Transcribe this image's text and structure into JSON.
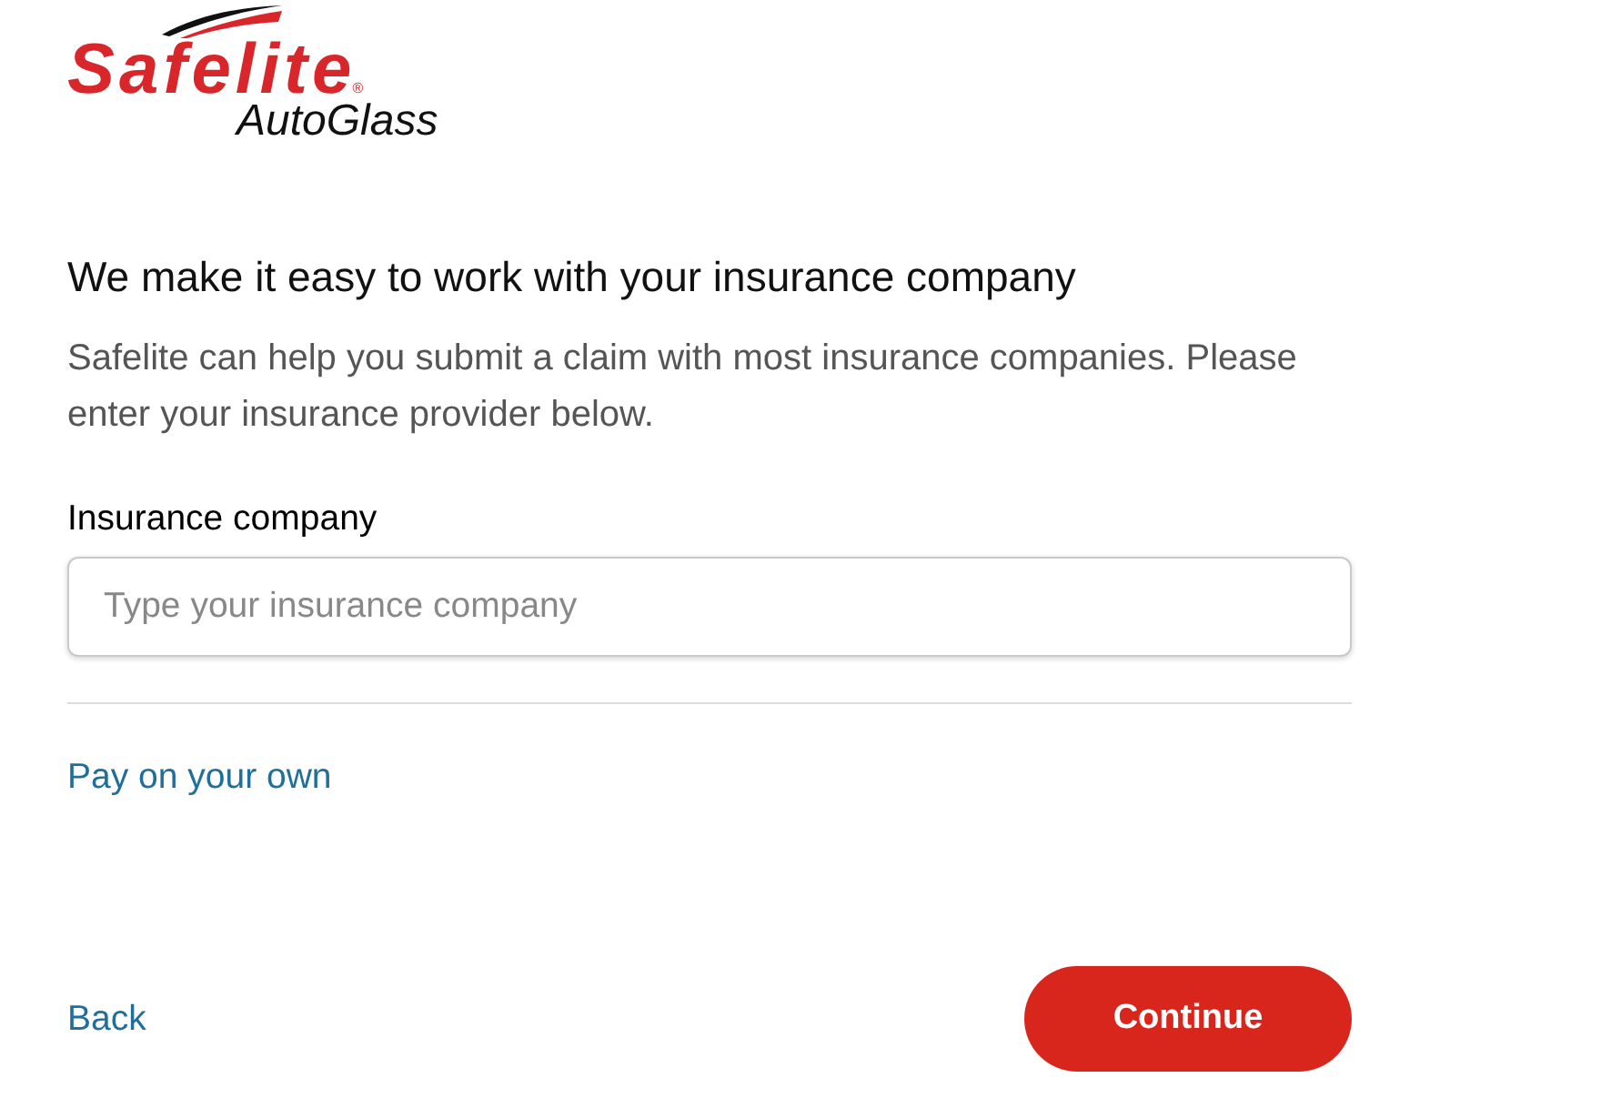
{
  "logo": {
    "wordmark": "Safelite",
    "registered": "®",
    "sub_brand": "AutoGlass"
  },
  "heading": "We make it easy to work with your insurance company",
  "intro": "Safelite can help you submit a claim with most insurance companies. Please enter your insurance provider below.",
  "insurance_field": {
    "label": "Insurance company",
    "placeholder": "Type your insurance company"
  },
  "alternate_link": "Pay on your own",
  "footer": {
    "back": "Back",
    "continue": "Continue"
  }
}
